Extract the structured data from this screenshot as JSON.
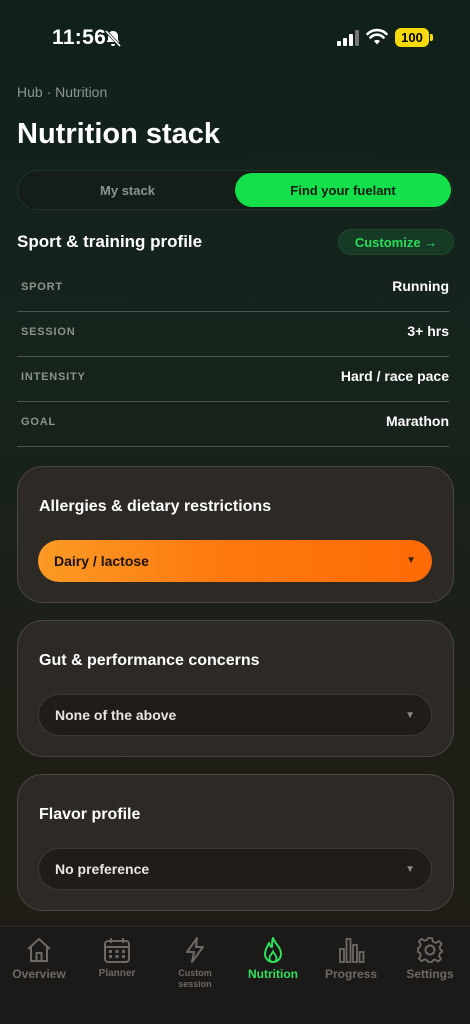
{
  "status_bar": {
    "time": "11:56",
    "battery": "100"
  },
  "breadcrumb": "Hub · Nutrition",
  "title": "Nutrition stack",
  "segment": {
    "tab1": "My stack",
    "tab2": "Find your fuelant",
    "active": "Find your fuelant"
  },
  "profile": {
    "title": "Sport & training profile",
    "customize": "Customize →",
    "rows": [
      {
        "key": "SPORT",
        "value": "Running"
      },
      {
        "key": "SESSION",
        "value": "3+ hrs"
      },
      {
        "key": "INTENSITY",
        "value": "Hard / race pace"
      },
      {
        "key": "GOAL",
        "value": "Marathon"
      }
    ]
  },
  "cards": [
    {
      "title": "Allergies & dietary restrictions",
      "value": "Dairy / lactose"
    },
    {
      "title": "Gut & performance concerns",
      "value": "None of the above"
    },
    {
      "title": "Flavor profile",
      "value": "No preference"
    }
  ],
  "caret": "▼",
  "tabs": [
    {
      "label": "Overview",
      "icon": "home-icon"
    },
    {
      "label": "Planner",
      "icon": "calendar-icon"
    },
    {
      "label": "Custom session",
      "icon": "bolt-icon"
    },
    {
      "label": "Nutrition",
      "icon": "flame-icon",
      "active": true
    },
    {
      "label": "Progress",
      "icon": "bar-chart-icon"
    },
    {
      "label": "Settings",
      "icon": "gear-icon"
    }
  ],
  "colors": {
    "accent_green": "#13e04a",
    "accent_orange": "#fd7a10"
  }
}
